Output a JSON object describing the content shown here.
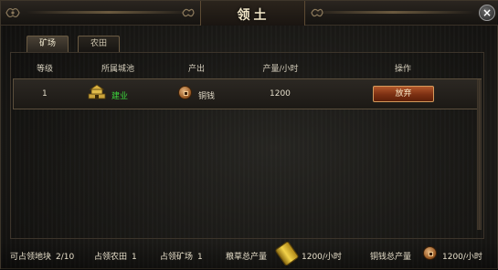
{
  "window": {
    "title": "领土",
    "close_glyph": "×",
    "icons": {
      "close": "close-icon",
      "ornament": "dragon-ornament-icon"
    }
  },
  "tabs": [
    {
      "label": "矿场",
      "active": true
    },
    {
      "label": "农田",
      "active": false
    }
  ],
  "table": {
    "columns": [
      "等级",
      "所属城池",
      "产出",
      "产量/小时",
      "操作"
    ],
    "rows": [
      {
        "level": "1",
        "city": "建业",
        "city_icon": "castle-icon",
        "output": "铜钱",
        "output_icon": "copper-coin-icon",
        "rate": "1200",
        "action": "放弃"
      }
    ]
  },
  "footer": {
    "plots_label": "可占领地块",
    "plots_value": "2/10",
    "farms_label": "占领农田",
    "farms_value": "1",
    "mines_label": "占领矿场",
    "mines_value": "1",
    "grain_label": "粮草总产量",
    "grain_icon": "grain-icon",
    "grain_value": "1200/小时",
    "copper_label": "铜钱总产量",
    "copper_icon": "copper-coin-icon",
    "copper_value": "1200/小时"
  },
  "colors": {
    "accent_button": "#8a3716",
    "city_text": "#3cd43c",
    "text": "#d8d2c2"
  }
}
